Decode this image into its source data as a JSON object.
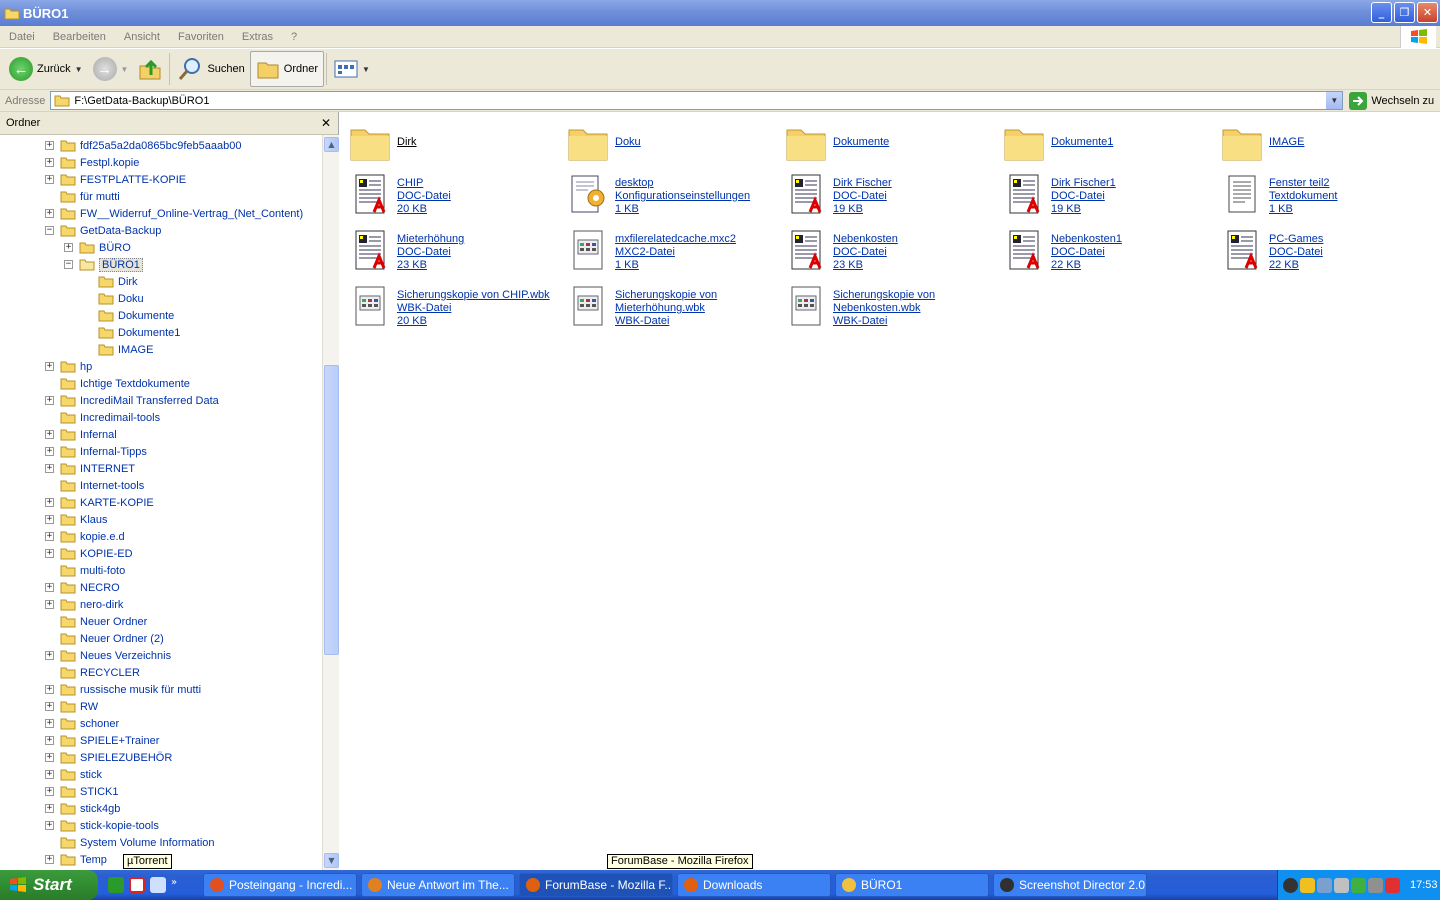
{
  "window": {
    "title": "BÜRO1",
    "buttons": {
      "minimize": "_",
      "maximize": "❐",
      "close": "✕"
    }
  },
  "menu": [
    "Datei",
    "Bearbeiten",
    "Ansicht",
    "Favoriten",
    "Extras",
    "?"
  ],
  "toolbar": {
    "back_label": "Zurück",
    "search_label": "Suchen",
    "folders_label": "Ordner"
  },
  "address": {
    "label": "Adresse",
    "value": "F:\\GetData-Backup\\BÜRO1",
    "go_label": "Wechseln zu"
  },
  "tree": {
    "header": "Ordner",
    "close_glyph": "✕",
    "items": [
      {
        "label": "fdf25a5a2da0865bc9feb5aaab00",
        "level": 0,
        "expander": "+"
      },
      {
        "label": "Festpl.kopie",
        "level": 0,
        "expander": "+"
      },
      {
        "label": "FESTPLATTE-KOPIE",
        "level": 0,
        "expander": "+"
      },
      {
        "label": "für mutti",
        "level": 0,
        "expander": ""
      },
      {
        "label": "FW__Widerruf_Online-Vertrag_(Net_Content)",
        "level": 0,
        "expander": "+"
      },
      {
        "label": "GetData-Backup",
        "level": 0,
        "expander": "−"
      },
      {
        "label": "BÜRO",
        "level": 1,
        "expander": "+"
      },
      {
        "label": "BÜRO1",
        "level": 1,
        "expander": "−",
        "selected": true
      },
      {
        "label": "Dirk",
        "level": 2,
        "expander": ""
      },
      {
        "label": "Doku",
        "level": 2,
        "expander": ""
      },
      {
        "label": "Dokumente",
        "level": 2,
        "expander": ""
      },
      {
        "label": "Dokumente1",
        "level": 2,
        "expander": ""
      },
      {
        "label": "IMAGE",
        "level": 2,
        "expander": ""
      },
      {
        "label": "hp",
        "level": 0,
        "expander": "+"
      },
      {
        "label": "Ichtige Textdokumente",
        "level": 0,
        "expander": ""
      },
      {
        "label": "IncrediMail Transferred Data",
        "level": 0,
        "expander": "+"
      },
      {
        "label": "Incredimail-tools",
        "level": 0,
        "expander": ""
      },
      {
        "label": "Infernal",
        "level": 0,
        "expander": "+"
      },
      {
        "label": "Infernal-Tipps",
        "level": 0,
        "expander": "+"
      },
      {
        "label": "INTERNET",
        "level": 0,
        "expander": "+"
      },
      {
        "label": "Internet-tools",
        "level": 0,
        "expander": ""
      },
      {
        "label": "KARTE-KOPIE",
        "level": 0,
        "expander": "+"
      },
      {
        "label": "Klaus",
        "level": 0,
        "expander": "+"
      },
      {
        "label": "kopie.e.d",
        "level": 0,
        "expander": "+"
      },
      {
        "label": "KOPIE-ED",
        "level": 0,
        "expander": "+"
      },
      {
        "label": "multi-foto",
        "level": 0,
        "expander": ""
      },
      {
        "label": "NECRO",
        "level": 0,
        "expander": "+"
      },
      {
        "label": "nero-dirk",
        "level": 0,
        "expander": "+"
      },
      {
        "label": "Neuer Ordner",
        "level": 0,
        "expander": ""
      },
      {
        "label": "Neuer Ordner (2)",
        "level": 0,
        "expander": ""
      },
      {
        "label": "Neues Verzeichnis",
        "level": 0,
        "expander": "+"
      },
      {
        "label": "RECYCLER",
        "level": 0,
        "expander": ""
      },
      {
        "label": "russische musik für mutti",
        "level": 0,
        "expander": "+"
      },
      {
        "label": "RW",
        "level": 0,
        "expander": "+"
      },
      {
        "label": "schoner",
        "level": 0,
        "expander": "+"
      },
      {
        "label": "SPIELE+Trainer",
        "level": 0,
        "expander": "+"
      },
      {
        "label": "SPIELEZUBEHÖR",
        "level": 0,
        "expander": "+"
      },
      {
        "label": "stick",
        "level": 0,
        "expander": "+"
      },
      {
        "label": "STICK1",
        "level": 0,
        "expander": "+"
      },
      {
        "label": "stick4gb",
        "level": 0,
        "expander": "+"
      },
      {
        "label": "stick-kopie-tools",
        "level": 0,
        "expander": "+"
      },
      {
        "label": "System Volume Information",
        "level": 0,
        "expander": ""
      },
      {
        "label": "Temp",
        "level": 0,
        "expander": "+"
      }
    ]
  },
  "files": [
    {
      "name": "Dirk",
      "type": "",
      "size": "",
      "icon": "folder-icon",
      "selected": true
    },
    {
      "name": "Doku",
      "type": "",
      "size": "",
      "icon": "folder-icon"
    },
    {
      "name": "Dokumente",
      "type": "",
      "size": "",
      "icon": "folder-icon"
    },
    {
      "name": "Dokumente1",
      "type": "",
      "size": "",
      "icon": "folder-icon"
    },
    {
      "name": "IMAGE",
      "type": "",
      "size": "",
      "icon": "folder-icon"
    },
    {
      "name": "CHIP",
      "type": "DOC-Datei",
      "size": "20 KB",
      "icon": "doc-icon"
    },
    {
      "name": "desktop",
      "type": "Konfigurationseinstellungen",
      "size": "1 KB",
      "icon": "config-icon"
    },
    {
      "name": "Dirk Fischer",
      "type": "DOC-Datei",
      "size": "19 KB",
      "icon": "doc-icon"
    },
    {
      "name": "Dirk Fischer1",
      "type": "DOC-Datei",
      "size": "19 KB",
      "icon": "doc-icon"
    },
    {
      "name": "Fenster teil2",
      "type": "Textdokument",
      "size": "1 KB",
      "icon": "text-icon"
    },
    {
      "name": "Mieterhöhung",
      "type": "DOC-Datei",
      "size": "23 KB",
      "icon": "doc-icon"
    },
    {
      "name": "mxfilerelatedcache.mxc2",
      "type": "MXC2-Datei",
      "size": "1 KB",
      "icon": "generic-file-icon"
    },
    {
      "name": "Nebenkosten",
      "type": "DOC-Datei",
      "size": "23 KB",
      "icon": "doc-icon"
    },
    {
      "name": "Nebenkosten1",
      "type": "DOC-Datei",
      "size": "22 KB",
      "icon": "doc-icon"
    },
    {
      "name": "PC-Games",
      "type": "DOC-Datei",
      "size": "22 KB",
      "icon": "doc-icon"
    },
    {
      "name": "Sicherungskopie von CHIP.wbk",
      "name2": "",
      "type": "WBK-Datei",
      "size": "20 KB",
      "icon": "generic-file-icon"
    },
    {
      "name": "Sicherungskopie von",
      "name2": "Mieterhöhung.wbk",
      "type": "WBK-Datei",
      "size": "",
      "icon": "generic-file-icon"
    },
    {
      "name": "Sicherungskopie von",
      "name2": "Nebenkosten.wbk",
      "type": "WBK-Datei",
      "size": "",
      "icon": "generic-file-icon"
    }
  ],
  "taskbar": {
    "start_label": "Start",
    "tasks": [
      {
        "label": "Posteingang - Incredi...",
        "color": "#e05020"
      },
      {
        "label": "Neue Antwort im The...",
        "color": "#e08020"
      },
      {
        "label": "ForumBase - Mozilla F...",
        "color": "#e06010",
        "active": true
      },
      {
        "label": "Downloads",
        "color": "#e06010"
      },
      {
        "label": "BÜRO1",
        "color": "#f0c040"
      },
      {
        "label": "Screenshot Director 2.0",
        "color": "#303030"
      }
    ],
    "clock": "17:53"
  },
  "tooltips": {
    "utorrent": "µTorrent",
    "firefox": "ForumBase - Mozilla Firefox"
  }
}
